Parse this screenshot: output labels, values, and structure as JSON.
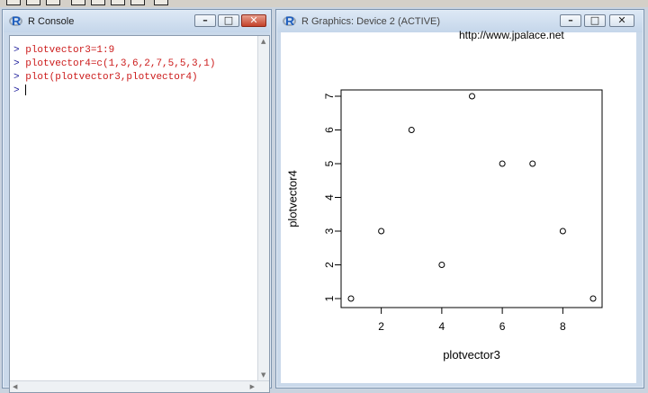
{
  "console_window": {
    "title": "R Console",
    "controls": [
      "minimize",
      "maximize",
      "close"
    ],
    "lines": [
      {
        "prompt": ">",
        "cmd": "plotvector3=1:9"
      },
      {
        "prompt": ">",
        "cmd": "plotvector4=c(1,3,6,2,7,5,5,3,1)"
      },
      {
        "prompt": ">",
        "cmd": "plot(plotvector3,plotvector4)"
      },
      {
        "prompt": ">",
        "cmd": ""
      }
    ]
  },
  "graphics_window": {
    "title": "R Graphics: Device 2 (ACTIVE)",
    "url_text": "http://www.jpalace.net"
  },
  "chart_data": {
    "type": "scatter",
    "x": [
      1,
      2,
      3,
      4,
      5,
      6,
      7,
      8,
      9
    ],
    "y": [
      1,
      3,
      6,
      2,
      7,
      5,
      5,
      3,
      1
    ],
    "xlabel": "plotvector3",
    "ylabel": "plotvector4",
    "xlim": [
      1,
      9
    ],
    "ylim": [
      1,
      7
    ],
    "xticks": [
      2,
      4,
      6,
      8
    ],
    "yticks": [
      1,
      2,
      3,
      4,
      5,
      6,
      7
    ],
    "marker": "open-circle",
    "grid": false
  }
}
